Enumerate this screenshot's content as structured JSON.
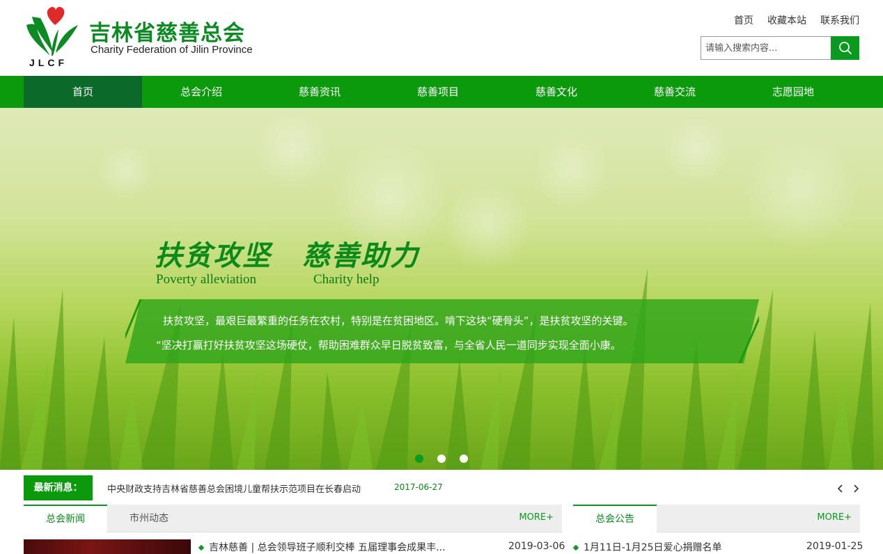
{
  "header": {
    "logo_text": "JLCF",
    "brand_cn": "吉林省慈善总会",
    "brand_en": "Charity Federation of Jilin Province",
    "top_links": [
      "首页",
      "收藏本站",
      "联系我们"
    ],
    "search_placeholder": "请输入搜索内容..."
  },
  "nav": {
    "items": [
      "首页",
      "总会介绍",
      "慈善资讯",
      "慈善项目",
      "慈善文化",
      "慈善交流",
      "志愿园地"
    ],
    "active_index": 0
  },
  "banner": {
    "slogan_cn_1": "扶贫攻坚",
    "slogan_cn_2": "慈善助力",
    "slogan_en_1": "Poverty alleviation",
    "slogan_en_2": "Charity help",
    "line_1": "扶贫攻坚，最艰巨最繁重的任务在农村，特别是在贫困地区。啃下这块“硬骨头”，是扶贫攻坚的关键。",
    "line_2": "“坚决打赢打好扶贫攻坚这场硬仗，帮助困难群众早日脱贫致富，与全省人民一道同步实现全面小康。",
    "slide_count": 3,
    "active_slide": 0
  },
  "ticker": {
    "label": "最新消息：",
    "headline": "中央财政支持吉林省慈善总会困境儿童帮扶示范项目在长春启动",
    "date": "2017-06-27"
  },
  "news_panel": {
    "tabs": [
      "总会新闻",
      "市州动态"
    ],
    "more": "MORE+",
    "items": [
      {
        "title": "吉林慈善 | 总会领导班子顺利交棒 五届理事会成果丰...",
        "date": "2019-03-06"
      }
    ]
  },
  "notice_panel": {
    "tabs": [
      "总会公告"
    ],
    "more": "MORE+",
    "items": [
      {
        "title": "1月11日-1月25日爱心捐赠名单",
        "date": "2019-01-25"
      }
    ]
  },
  "colors": {
    "brand_green": "#0a9a0c",
    "nav_active": "#0b6a2a",
    "heart_red": "#e02a2a"
  }
}
